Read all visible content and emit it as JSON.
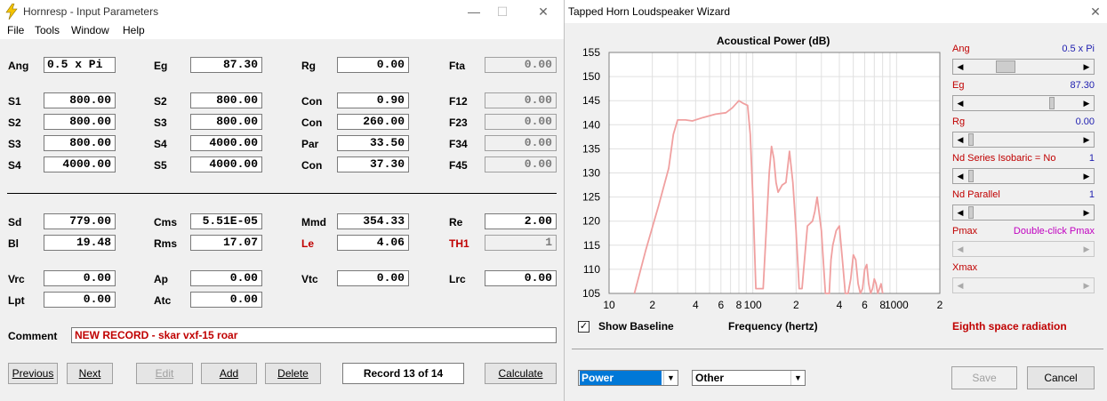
{
  "left_window": {
    "title": "Hornresp - Input Parameters",
    "menu": [
      "File",
      "Tools",
      "Window",
      "Help"
    ],
    "fields": [
      {
        "label": "Ang",
        "value": "0.5 x Pi",
        "align": "left"
      },
      {
        "label": "Eg",
        "value": "87.30"
      },
      {
        "label": "Rg",
        "value": "0.00"
      },
      {
        "label": "Fta",
        "value": "0.00",
        "dim": true
      },
      {
        "label": "S1",
        "value": "800.00"
      },
      {
        "label": "S2",
        "value": "800.00"
      },
      {
        "label": "Con",
        "value": "0.90"
      },
      {
        "label": "F12",
        "value": "0.00",
        "dim": true
      },
      {
        "label": "S2",
        "value": "800.00"
      },
      {
        "label": "S3",
        "value": "800.00"
      },
      {
        "label": "Con",
        "value": "260.00"
      },
      {
        "label": "F23",
        "value": "0.00",
        "dim": true
      },
      {
        "label": "S3",
        "value": "800.00"
      },
      {
        "label": "S4",
        "value": "4000.00"
      },
      {
        "label": "Par",
        "value": "33.50"
      },
      {
        "label": "F34",
        "value": "0.00",
        "dim": true
      },
      {
        "label": "S4",
        "value": "4000.00"
      },
      {
        "label": "S5",
        "value": "4000.00"
      },
      {
        "label": "Con",
        "value": "37.30"
      },
      {
        "label": "F45",
        "value": "0.00",
        "dim": true
      },
      {
        "label": "Sd",
        "value": "779.00"
      },
      {
        "label": "Cms",
        "value": "5.51E-05"
      },
      {
        "label": "Mmd",
        "value": "354.33"
      },
      {
        "label": "Re",
        "value": "2.00"
      },
      {
        "label": "Bl",
        "value": "19.48"
      },
      {
        "label": "Rms",
        "value": "17.07"
      },
      {
        "label": "Le",
        "value": "4.06",
        "red": true
      },
      {
        "label": "TH1",
        "value": "1",
        "red": true,
        "dim": true
      },
      {
        "label": "Vrc",
        "value": "0.00"
      },
      {
        "label": "Ap",
        "value": "0.00"
      },
      {
        "label": "Vtc",
        "value": "0.00"
      },
      {
        "label": "Lrc",
        "value": "0.00"
      },
      {
        "label": "Lpt",
        "value": "0.00"
      },
      {
        "label": "Atc",
        "value": "0.00"
      }
    ],
    "comment_label": "Comment",
    "comment": "NEW RECORD - skar vxf-15 roar",
    "buttons": {
      "previous": "Previous",
      "next": "Next",
      "edit": "Edit",
      "add": "Add",
      "delete": "Delete",
      "calculate": "Calculate"
    },
    "record": "Record 13 of 14"
  },
  "right_window": {
    "title": "Tapped Horn Loudspeaker Wizard",
    "show_baseline": "Show Baseline",
    "chart_data": {
      "type": "line",
      "title": "Acoustical Power (dB)",
      "xlabel": "Frequency (hertz)",
      "ylabel": "",
      "xscale": "log",
      "xlim": [
        10,
        2000
      ],
      "ylim": [
        105,
        155
      ],
      "yticks": [
        105,
        110,
        115,
        120,
        125,
        130,
        135,
        140,
        145,
        150,
        155
      ],
      "xticks": [
        "10",
        "2",
        "4",
        "6",
        "8",
        "100",
        "2",
        "4",
        "6",
        "8",
        "1000",
        "2"
      ],
      "grid": true,
      "line_color": "#f0a0a0",
      "series": [
        {
          "x": [
            15,
            18,
            22,
            26,
            28,
            30,
            34,
            38,
            45,
            55,
            65,
            72,
            80,
            85,
            92,
            96,
            100,
            105,
            110,
            118,
            125,
            130,
            135,
            140,
            145,
            150,
            160,
            170,
            180,
            190,
            200,
            210,
            220,
            240,
            260,
            270,
            280,
            300,
            320,
            340,
            350,
            360,
            380,
            400,
            420,
            440,
            460,
            480,
            500,
            520,
            540,
            560,
            580,
            600,
            620,
            640,
            660,
            680,
            700,
            720,
            740,
            760,
            780,
            800
          ],
          "y": [
            105,
            114,
            123,
            131,
            138,
            141,
            141,
            140.8,
            141.5,
            142.2,
            142.5,
            143.5,
            145,
            144.5,
            144,
            138,
            125,
            106,
            106,
            106,
            120,
            130,
            135.5,
            133,
            128,
            126,
            127.5,
            128,
            134.5,
            128,
            118,
            106,
            106,
            119,
            120,
            122,
            125,
            118,
            105,
            105,
            112,
            115,
            118,
            119,
            112,
            105,
            105,
            108,
            113,
            112,
            107,
            105,
            106,
            110,
            111,
            107,
            105,
            106,
            108,
            107,
            105,
            106,
            107,
            105
          ]
        }
      ]
    },
    "params": {
      "ang": {
        "label": "Ang",
        "value": "0.5 x Pi"
      },
      "eg": {
        "label": "Eg",
        "value": "87.30"
      },
      "rg": {
        "label": "Rg",
        "value": "0.00"
      },
      "nd_series": {
        "label": "Nd Series   Isobaric = No",
        "value": "1"
      },
      "nd_parallel": {
        "label": "Nd  Parallel",
        "value": "1"
      },
      "pmax": {
        "label": "Pmax",
        "value": "Double-click Pmax"
      },
      "xmax": {
        "label": "Xmax",
        "value": ""
      }
    },
    "radiation": "Eighth space radiation",
    "combo1": "Power",
    "combo2": "Other",
    "save": "Save",
    "cancel": "Cancel",
    "accent_red": "#c00000",
    "accent_blue": "#2020b0"
  }
}
